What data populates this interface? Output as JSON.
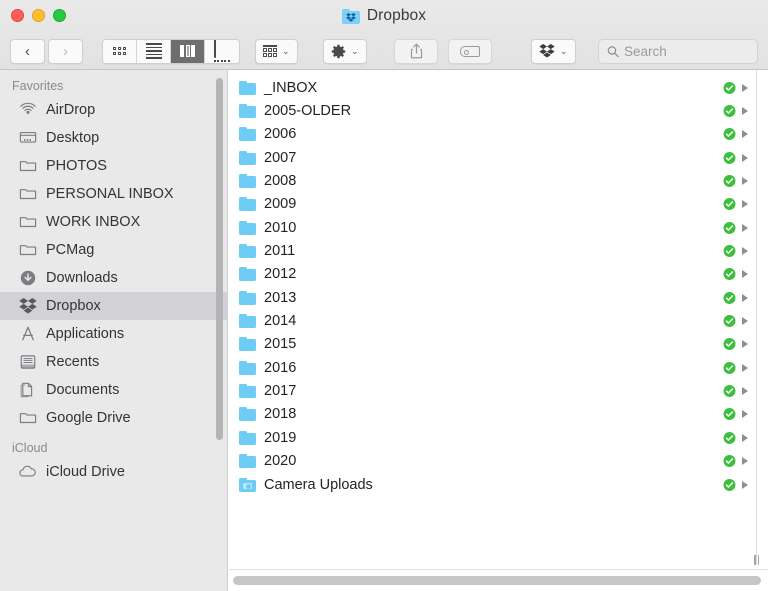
{
  "window": {
    "title": "Dropbox",
    "title_icon": "dropbox-folder-icon",
    "traffic_lights": [
      {
        "name": "close",
        "color": "#ff5f57"
      },
      {
        "name": "minimize",
        "color": "#ffbd2e"
      },
      {
        "name": "maximize",
        "color": "#28c840"
      }
    ]
  },
  "toolbar": {
    "back_label": "‹",
    "forward_label": "›",
    "view_modes": [
      {
        "name": "icon-view",
        "active": false
      },
      {
        "name": "list-view",
        "active": false
      },
      {
        "name": "column-view",
        "active": true
      },
      {
        "name": "gallery-view",
        "active": false
      }
    ],
    "arrange_chevron": "⌄",
    "gear_chevron": "⌄",
    "dropbox_chevron": "⌄",
    "share_label": "share-icon",
    "tag_label": "tag-icon"
  },
  "search": {
    "placeholder": "Search",
    "value": ""
  },
  "sidebar": {
    "sections": [
      {
        "header": "Favorites",
        "items": [
          {
            "label": "AirDrop",
            "icon": "airdrop-icon",
            "selected": false
          },
          {
            "label": "Desktop",
            "icon": "desktop-icon",
            "selected": false
          },
          {
            "label": "PHOTOS",
            "icon": "folder-icon",
            "selected": false
          },
          {
            "label": "PERSONAL INBOX",
            "icon": "folder-icon",
            "selected": false
          },
          {
            "label": "WORK INBOX",
            "icon": "folder-icon",
            "selected": false
          },
          {
            "label": "PCMag",
            "icon": "folder-icon",
            "selected": false
          },
          {
            "label": "Downloads",
            "icon": "downloads-icon",
            "selected": false
          },
          {
            "label": "Dropbox",
            "icon": "dropbox-icon",
            "selected": true
          },
          {
            "label": "Applications",
            "icon": "applications-icon",
            "selected": false
          },
          {
            "label": "Recents",
            "icon": "recents-icon",
            "selected": false
          },
          {
            "label": "Documents",
            "icon": "documents-icon",
            "selected": false
          },
          {
            "label": "Google Drive",
            "icon": "folder-icon",
            "selected": false
          }
        ]
      },
      {
        "header": "iCloud",
        "items": [
          {
            "label": "iCloud Drive",
            "icon": "cloud-icon",
            "selected": false
          }
        ]
      }
    ]
  },
  "files": [
    {
      "name": "_INBOX",
      "icon": "folder-icon",
      "status": "synced",
      "has_arrow": true
    },
    {
      "name": "2005-OLDER",
      "icon": "folder-icon",
      "status": "synced",
      "has_arrow": true
    },
    {
      "name": "2006",
      "icon": "folder-icon",
      "status": "synced",
      "has_arrow": true
    },
    {
      "name": "2007",
      "icon": "folder-icon",
      "status": "synced",
      "has_arrow": true
    },
    {
      "name": "2008",
      "icon": "folder-icon",
      "status": "synced",
      "has_arrow": true
    },
    {
      "name": "2009",
      "icon": "folder-icon",
      "status": "synced",
      "has_arrow": true
    },
    {
      "name": "2010",
      "icon": "folder-icon",
      "status": "synced",
      "has_arrow": true
    },
    {
      "name": "2011",
      "icon": "folder-icon",
      "status": "synced",
      "has_arrow": true
    },
    {
      "name": "2012",
      "icon": "folder-icon",
      "status": "synced",
      "has_arrow": true
    },
    {
      "name": "2013",
      "icon": "folder-icon",
      "status": "synced",
      "has_arrow": true
    },
    {
      "name": "2014",
      "icon": "folder-icon",
      "status": "synced",
      "has_arrow": true
    },
    {
      "name": "2015",
      "icon": "folder-icon",
      "status": "synced",
      "has_arrow": true
    },
    {
      "name": "2016",
      "icon": "folder-icon",
      "status": "synced",
      "has_arrow": true
    },
    {
      "name": "2017",
      "icon": "folder-icon",
      "status": "synced",
      "has_arrow": true
    },
    {
      "name": "2018",
      "icon": "folder-icon",
      "status": "synced",
      "has_arrow": true
    },
    {
      "name": "2019",
      "icon": "folder-icon",
      "status": "synced",
      "has_arrow": true
    },
    {
      "name": "2020",
      "icon": "folder-icon",
      "status": "synced",
      "has_arrow": true
    },
    {
      "name": "Camera Uploads",
      "icon": "camera-folder-icon",
      "status": "synced",
      "has_arrow": true
    }
  ],
  "colors": {
    "folder_blue": "#6fcdf5",
    "sync_green": "#3cbf3c",
    "selection_gray": "#d2d2d6",
    "sidebar_bg": "#e9e9ea",
    "titlebar_bg": "#e6e6e6"
  }
}
